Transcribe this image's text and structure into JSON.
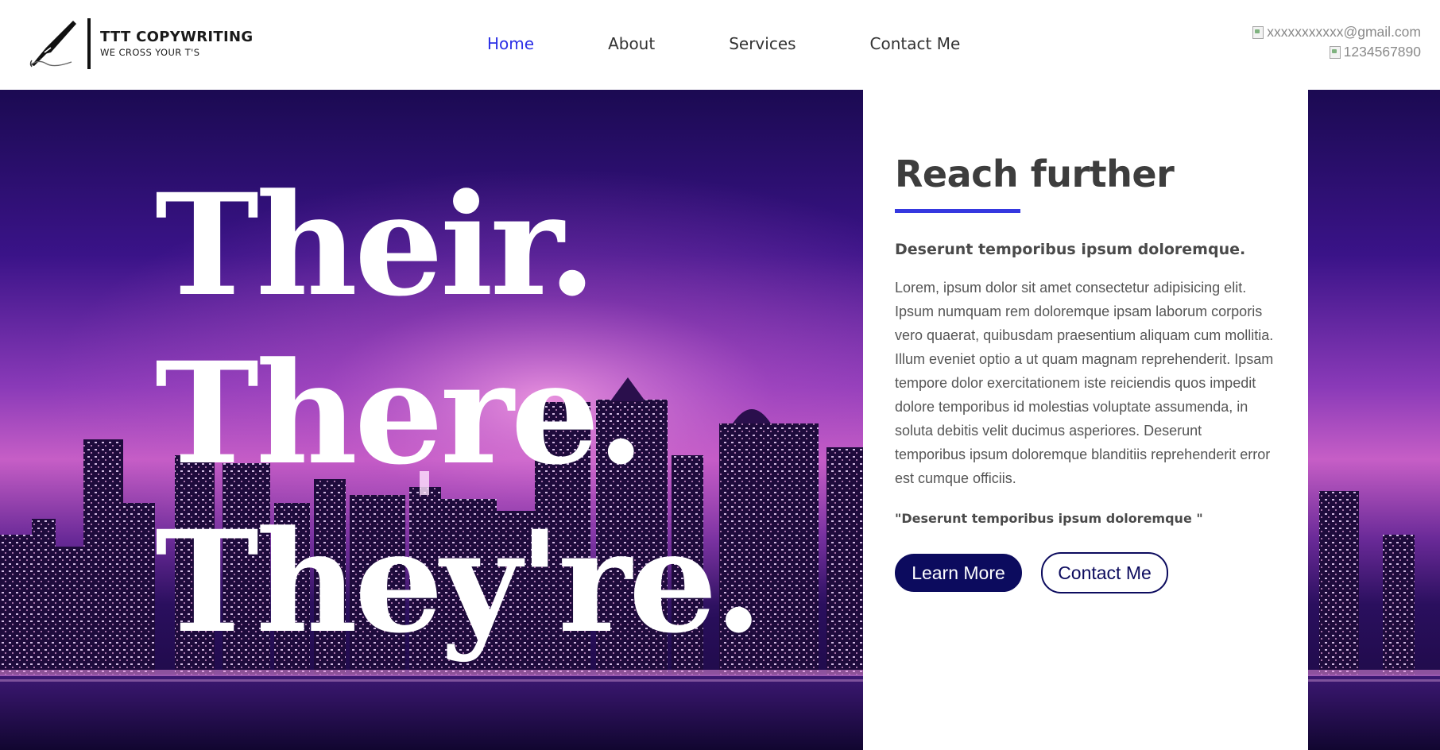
{
  "brand": {
    "name": "TTT COPYWRITING",
    "tagline": "WE CROSS YOUR T'S",
    "logo_icon": "fountain-pen-icon"
  },
  "nav": {
    "items": [
      {
        "label": "Home",
        "active": true
      },
      {
        "label": "About",
        "active": false
      },
      {
        "label": "Services",
        "active": false
      },
      {
        "label": "Contact Me",
        "active": false
      }
    ]
  },
  "contact": {
    "email": "xxxxxxxxxxx@gmail.com",
    "phone": "1234567890"
  },
  "hero": {
    "lines": [
      "Their.",
      "There.",
      "They're."
    ]
  },
  "card": {
    "title": "Reach further",
    "subtitle": "Deserunt temporibus ipsum doloremque.",
    "body": "Lorem, ipsum dolor sit amet consectetur adipisicing elit. Ipsum numquam rem doloremque ipsam laborum corporis vero quaerat, quibusdam praesentium aliquam cum mollitia. Illum eveniet optio a ut quam magnam reprehenderit. Ipsam tempore dolor exercitationem iste reiciendis quos impedit dolore temporibus id molestias voluptate assumenda, in soluta debitis velit ducimus asperiores. Deserunt temporibus ipsum doloremque blanditiis reprehenderit error est cumque officiis.",
    "quote": "\"Deserunt temporibus ipsum doloremque \"",
    "primary_button": "Learn More",
    "secondary_button": "Contact Me"
  },
  "colors": {
    "accent": "#3538e0",
    "nav_active": "#2b2fe6",
    "button_navy": "#0c0b5e",
    "text_dark": "#3d3d3d"
  }
}
